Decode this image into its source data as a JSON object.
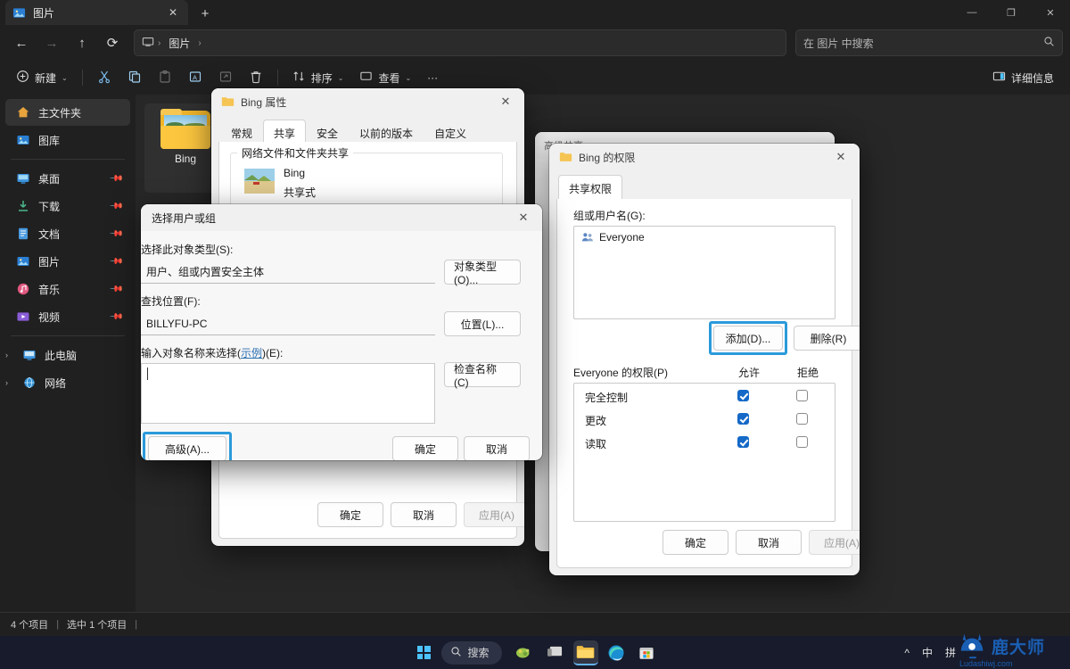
{
  "window": {
    "tab_title": "图片",
    "tab_close": "✕",
    "new_tab": "+",
    "minimize": "—",
    "maximize": "❐",
    "close": "✕"
  },
  "nav": {
    "back": "←",
    "forward": "→",
    "up": "↑",
    "refresh": "⟳",
    "breadcrumb": [
      "图片"
    ],
    "breadcrumb_sep": "›",
    "search_placeholder": "在 图片 中搜索",
    "search_icon": "search-icon"
  },
  "toolbar": {
    "new_label": "新建",
    "cut": "cut-icon",
    "copy": "copy-icon",
    "paste": "paste-icon",
    "rename": "rename-icon",
    "share": "share-icon",
    "delete": "delete-icon",
    "sort_label": "排序",
    "view_label": "查看",
    "more_label": "···",
    "details_label": "详细信息",
    "chevron": "⌄"
  },
  "sidebar": {
    "items": [
      {
        "label": "主文件夹",
        "icon": "home-icon",
        "selected": true,
        "pinned": false,
        "expand": false
      },
      {
        "label": "图库",
        "icon": "gallery-icon",
        "selected": false,
        "pinned": false,
        "expand": false
      },
      {
        "label": "桌面",
        "icon": "desktop-icon",
        "selected": false,
        "pinned": true,
        "expand": false
      },
      {
        "label": "下载",
        "icon": "download-icon",
        "selected": false,
        "pinned": true,
        "expand": false
      },
      {
        "label": "文档",
        "icon": "document-icon",
        "selected": false,
        "pinned": true,
        "expand": false
      },
      {
        "label": "图片",
        "icon": "pictures-icon",
        "selected": false,
        "pinned": true,
        "expand": false
      },
      {
        "label": "音乐",
        "icon": "music-icon",
        "selected": false,
        "pinned": true,
        "expand": false
      },
      {
        "label": "视频",
        "icon": "video-icon",
        "selected": false,
        "pinned": true,
        "expand": false
      },
      {
        "label": "此电脑",
        "icon": "this-pc-icon",
        "selected": false,
        "pinned": false,
        "expand": true
      },
      {
        "label": "网络",
        "icon": "network-icon",
        "selected": false,
        "pinned": false,
        "expand": true
      }
    ],
    "pin_glyph": "📌",
    "expand_glyph": "›"
  },
  "files": [
    {
      "name": "Bing",
      "type": "folder"
    }
  ],
  "statusbar": {
    "count": "4 个项目",
    "sep": "|",
    "selection": "选中 1 个项目"
  },
  "properties_dialog": {
    "title": "Bing 属性",
    "close": "✕",
    "tabs": [
      {
        "label": "常规",
        "active": false
      },
      {
        "label": "共享",
        "active": true
      },
      {
        "label": "安全",
        "active": false
      },
      {
        "label": "以前的版本",
        "active": false
      },
      {
        "label": "自定义",
        "active": false
      }
    ],
    "group_title": "网络文件和文件夹共享",
    "share_name": "Bing",
    "share_state": "共享式",
    "buttons": [
      {
        "label": "确定",
        "disabled": false
      },
      {
        "label": "取消",
        "disabled": false
      },
      {
        "label": "应用(A)",
        "disabled": true
      }
    ]
  },
  "advanced_sharing_dialog": {
    "title": "高级共享",
    "collapse": "⌄"
  },
  "permissions_dialog": {
    "title": "Bing 的权限",
    "close": "✕",
    "tabs": [
      {
        "label": "共享权限",
        "active": true
      }
    ],
    "group_users_label": "组或用户名(G):",
    "users": [
      {
        "name": "Everyone",
        "icon": "users-group-icon",
        "selected": true
      }
    ],
    "add_button": "添加(D)...",
    "remove_button": "删除(R)",
    "permissions_label": "Everyone 的权限(P)",
    "col_allow": "允许",
    "col_deny": "拒绝",
    "permission_rows": [
      {
        "name": "完全控制",
        "allow": true,
        "deny": false
      },
      {
        "name": "更改",
        "allow": true,
        "deny": false
      },
      {
        "name": "读取",
        "allow": true,
        "deny": false
      }
    ],
    "buttons": [
      {
        "label": "确定",
        "disabled": false
      },
      {
        "label": "取消",
        "disabled": false
      },
      {
        "label": "应用(A)",
        "disabled": true
      }
    ]
  },
  "select_users_dialog": {
    "title": "选择用户或组",
    "close": "✕",
    "object_type_label": "选择此对象类型(S):",
    "object_type_value": "用户、组或内置安全主体",
    "object_type_button": "对象类型(O)...",
    "location_label": "查找位置(F):",
    "location_value": "BILLYFU-PC",
    "location_button": "位置(L)...",
    "names_label_prefix": "输入对象名称来选择(",
    "names_label_link": "示例",
    "names_label_suffix": ")(E):",
    "names_value": "",
    "check_names_button": "检查名称(C)",
    "advanced_button": "高级(A)...",
    "ok_button": "确定",
    "cancel_button": "取消"
  },
  "taskbar": {
    "start": "start-button",
    "search_placeholder": "搜索",
    "apps": [
      {
        "name": "widgets-icon"
      },
      {
        "name": "task-view-icon"
      },
      {
        "name": "file-explorer-icon",
        "active": true
      },
      {
        "name": "edge-icon"
      },
      {
        "name": "microsoft-store-icon"
      }
    ],
    "tray": [
      "^",
      "中",
      "拼"
    ],
    "watermark": "鹿大师",
    "watermark_url": "Ludashiwj.com"
  },
  "colors": {
    "accent_blue": "#2b9ada",
    "checkbox_blue": "#1569c7",
    "explorer_bg": "#202020",
    "content_bg": "#272727",
    "dialog_bg": "#f0f0f0"
  }
}
